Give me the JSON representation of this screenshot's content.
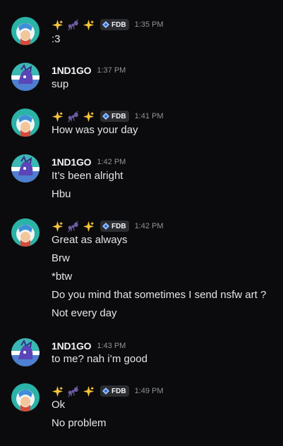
{
  "users": {
    "sparkle": {
      "display_emoji": [
        "sparkles-emoji",
        "ant-emoji",
        "sparkles-emoji"
      ],
      "tag_label": "FDB"
    },
    "indigo": {
      "name": "1ND1GO"
    }
  },
  "messages": [
    {
      "author": "sparkle",
      "time": "1:35 PM",
      "lines": [
        ":3"
      ]
    },
    {
      "author": "indigo",
      "time": "1:37 PM",
      "lines": [
        "sup"
      ]
    },
    {
      "author": "sparkle",
      "time": "1:41 PM",
      "lines": [
        "How was your day"
      ]
    },
    {
      "author": "indigo",
      "time": "1:42 PM",
      "lines": [
        "It’s been alright",
        "Hbu"
      ]
    },
    {
      "author": "sparkle",
      "time": "1:42 PM",
      "lines": [
        "Great as always",
        "Brw",
        "*btw",
        "Do you mind that sometimes I send nsfw art ?",
        "Not every day"
      ]
    },
    {
      "author": "indigo",
      "time": "1:43 PM",
      "lines": [
        "to me? nah i’m good"
      ]
    },
    {
      "author": "sparkle",
      "time": "1:49 PM",
      "lines": [
        "Ok",
        "No problem"
      ]
    }
  ],
  "colors": {
    "background": "#0b0b0d",
    "username": "#f2f3f5",
    "timestamp": "#8e9297",
    "message_text": "#e3e5e8",
    "tag_background": "#2b2d31"
  }
}
